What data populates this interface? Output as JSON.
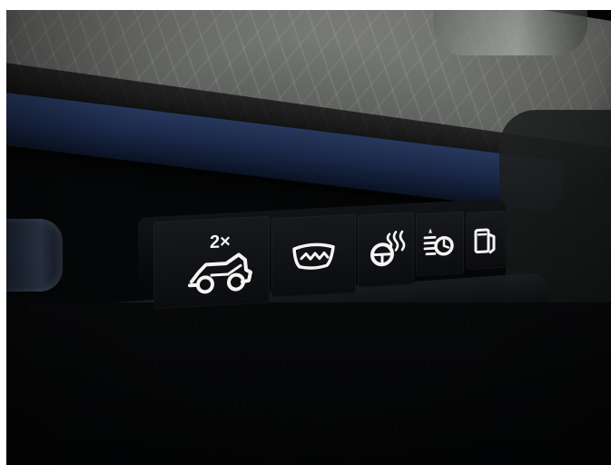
{
  "photo": {
    "subject": "car-dashboard-switch-panel",
    "colors": {
      "dashboard_top": "#6d6f6c",
      "blue_trim": "#1a2747",
      "panel_black": "#050607",
      "icon_white": "#f2f2f2"
    },
    "switches": [
      {
        "icon": "rear-trunk-2x-icon",
        "label": "2×"
      },
      {
        "icon": "windshield-defrost-icon"
      },
      {
        "icon": "heated-steering-wheel-icon"
      },
      {
        "icon": "rear-fog-light-icon"
      },
      {
        "icon": "fuel-door-icon"
      }
    ]
  }
}
